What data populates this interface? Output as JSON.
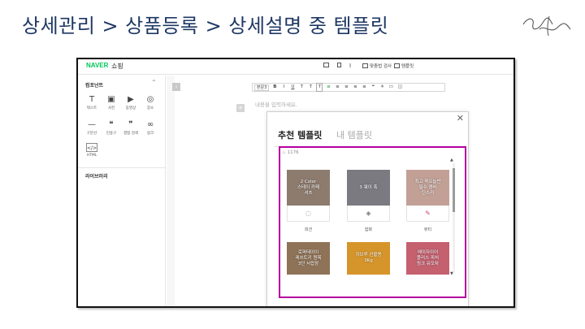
{
  "slide": {
    "title": "상세관리 > 상품등록 > 상세설명 중 템플릿"
  },
  "app": {
    "brand": "NAVER",
    "brand_sub": "쇼핑",
    "top_actions": [
      {
        "icon": "monitor-icon",
        "label": ""
      },
      {
        "icon": "mobile-icon",
        "label": ""
      },
      {
        "icon": "text-format-icon",
        "label": ""
      },
      {
        "icon": "spellcheck-icon",
        "label": "맞춤법 검사"
      },
      {
        "icon": "template-icon",
        "label": "템플릿"
      }
    ]
  },
  "sidebar": {
    "section_label": "컴포넌트",
    "library_label": "라이브러리",
    "tools": [
      {
        "icon": "text-icon",
        "glyph": "T",
        "label": "텍스트"
      },
      {
        "icon": "photo-icon",
        "glyph": "▣",
        "label": "사진"
      },
      {
        "icon": "video-icon",
        "glyph": "▶",
        "label": "동영상"
      },
      {
        "icon": "location-icon",
        "glyph": "◎",
        "label": "장소"
      },
      {
        "icon": "divider-icon",
        "glyph": "—",
        "label": "구분선"
      },
      {
        "icon": "quote-icon",
        "glyph": "❝",
        "label": "인용구"
      },
      {
        "icon": "simple-search-icon",
        "glyph": "❞",
        "label": "결합 검색"
      },
      {
        "icon": "link-icon",
        "glyph": "∞",
        "label": "링크"
      },
      {
        "icon": "html-icon",
        "glyph": "</>",
        "label": "HTML"
      }
    ]
  },
  "editor": {
    "text_style": "본문3",
    "toolbar_buttons": [
      "B",
      "I",
      "U",
      "T",
      "T",
      "T",
      "≡",
      "≡",
      "≡",
      "≡",
      "≡",
      "❝",
      "✳",
      "▭",
      "◫"
    ],
    "placeholder": "내용을 입력하세요."
  },
  "modal": {
    "tab_recommended": "추천 템플릿",
    "tab_mine": "내 템플릿",
    "count": "♨ 1176",
    "templates": [
      {
        "title": "2 Color\n스테이 카페\n셔츠",
        "caption": "피션",
        "icon": "fashion-icon",
        "glyph": "◌",
        "color": "#8d7b6e"
      },
      {
        "title": "3 웨이 폭",
        "caption": "잡화",
        "icon": "goods-icon",
        "glyph": "◈",
        "color": "#7b7a80"
      },
      {
        "title": "최고 퀵오늘반\n필수 엠바\n틴스커",
        "caption": "뷰티",
        "icon": "beauty-icon",
        "glyph": "✎",
        "color": "#c2a096"
      },
      {
        "title": "로퍼테이이\n레쓰트키 원목\n3단 서랍장",
        "caption": "",
        "icon": "",
        "glyph": "",
        "color": "#8f7358"
      },
      {
        "title": "하브루 선물용\n3Kg",
        "caption": "",
        "icon": "",
        "glyph": "",
        "color": "#d6952a"
      },
      {
        "title": "에이자이어\n플러스 피처\n링크 유모차",
        "caption": "",
        "icon": "",
        "glyph": "",
        "color": "#c5606f"
      }
    ]
  }
}
